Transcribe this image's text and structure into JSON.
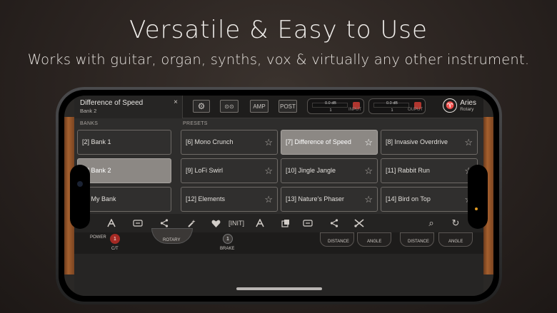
{
  "headline": "Versatile & Easy to Use",
  "subline": "Works with guitar, organ, synths, vox & virtually any other instrument.",
  "app": {
    "preset_title": "Difference of Speed",
    "preset_bank": "Bank 2",
    "close": "×",
    "tabs": [
      {
        "label": "⚙",
        "icon": "gear-icon"
      },
      {
        "label": "⊙⊙",
        "icon": "tape-icon"
      },
      {
        "label": "AMP"
      },
      {
        "label": "POST"
      }
    ],
    "input_meter": {
      "value": "0.0 dB",
      "knob": "1",
      "label": "INPUT"
    },
    "output_meter": {
      "value": "0.0 dB",
      "knob": "1",
      "label": "OUPUT"
    },
    "brand": {
      "name": "Aries",
      "sub": "Rotary",
      "logo": "♈"
    },
    "banks_label": "BANKS",
    "presets_label": "PRESETS",
    "banks": [
      {
        "label": "[2] Bank 1",
        "selected": false
      },
      {
        "label": "[3] Bank 2",
        "selected": true
      },
      {
        "label": "[4] My Bank",
        "selected": false
      }
    ],
    "presets": [
      {
        "label": "[6] Mono Crunch",
        "selected": false
      },
      {
        "label": "[7] Difference of Speed",
        "selected": true
      },
      {
        "label": "[8] Invasive Overdrive",
        "selected": false
      },
      {
        "label": "[9] LoFi Swirl",
        "selected": false
      },
      {
        "label": "[10] Jingle Jangle",
        "selected": false
      },
      {
        "label": "[11] Rabbit Run",
        "selected": false
      },
      {
        "label": "[12] Elements",
        "selected": false
      },
      {
        "label": "[13] Nature’s Phaser",
        "selected": false
      },
      {
        "label": "[14] Bird on Top",
        "selected": false
      }
    ],
    "star": "☆",
    "toolbar": {
      "init": "[INIT]",
      "add": "+",
      "search": "⌕",
      "refresh": "↻"
    },
    "amp": {
      "power": "POWER",
      "ct": "C/T",
      "rotary": "ROTARY",
      "brake": "BRAKE",
      "distance": "DISTANCE",
      "angle": "ANGLE",
      "dot": "1"
    }
  }
}
